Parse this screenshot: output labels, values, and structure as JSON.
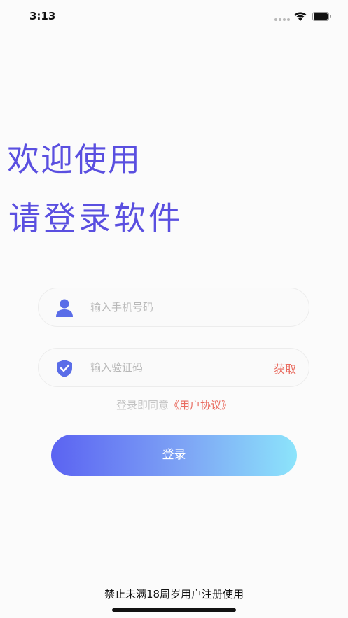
{
  "status_bar": {
    "time": "3:13"
  },
  "header": {
    "welcome": "欢迎使用",
    "subtitle": "请登录软件"
  },
  "form": {
    "phone": {
      "placeholder": "输入手机号码",
      "value": "",
      "icon": "user-icon"
    },
    "code": {
      "placeholder": "输入验证码",
      "value": "",
      "icon": "shield-check-icon",
      "get_code_label": "获取"
    },
    "agreement": {
      "prefix": "登录即同意",
      "link": "《用户协议》"
    },
    "login_label": "登录"
  },
  "footer": {
    "notice": "禁止未满18周岁用户注册使用"
  },
  "colors": {
    "accent": "#5a4fe0",
    "link": "#e96a5e",
    "icon_blue": "#5a6de8"
  }
}
